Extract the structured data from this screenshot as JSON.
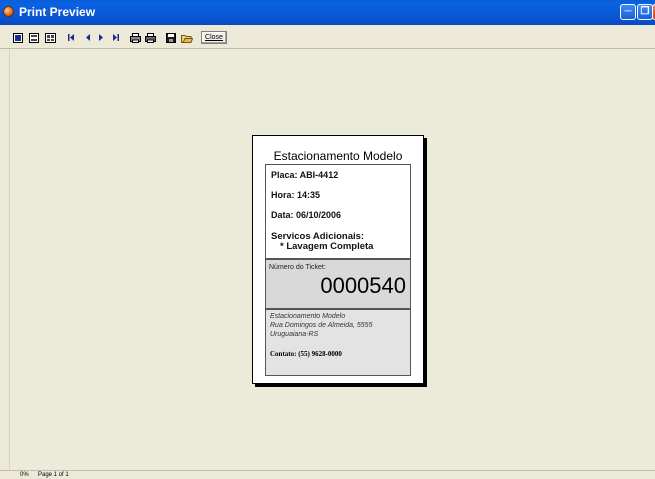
{
  "window": {
    "title": "Print Preview"
  },
  "toolbar": {
    "buttons": [
      {
        "icon": "one-page-icon"
      },
      {
        "icon": "two-pages-icon"
      },
      {
        "icon": "multiple-pages-icon"
      },
      {
        "icon": "first-page-icon"
      },
      {
        "icon": "previous-page-icon"
      },
      {
        "icon": "next-page-icon"
      },
      {
        "icon": "last-page-icon"
      },
      {
        "icon": "print-icon"
      },
      {
        "icon": "print-setup-icon"
      },
      {
        "icon": "save-icon"
      },
      {
        "icon": "open-icon"
      }
    ],
    "close_label": "Close"
  },
  "ticket": {
    "title": "Estacionamento Modelo",
    "placa": "Placa: ABI-4412",
    "hora": "Hora: 14:35",
    "data": "Data: 06/10/2006",
    "servicos_label": "Servicos Adicionais:",
    "servicos_item": "* Lavagem Completa",
    "ticket_label": "Número do Ticket:",
    "ticket_number": "0000540",
    "address_line1": "Estacionamento Modelo",
    "address_line2": "Rua Domingos de Almeida, 5555",
    "address_line3": "Uruguaiana-RS",
    "contact": "Contato: (55) 9628-0000"
  },
  "status": {
    "zoom": "0%",
    "page": "Page 1 of 1"
  },
  "colors": {
    "titlebar": "#0a5fd8",
    "background": "#ece9d8",
    "preview_bg": "#ecead8"
  }
}
